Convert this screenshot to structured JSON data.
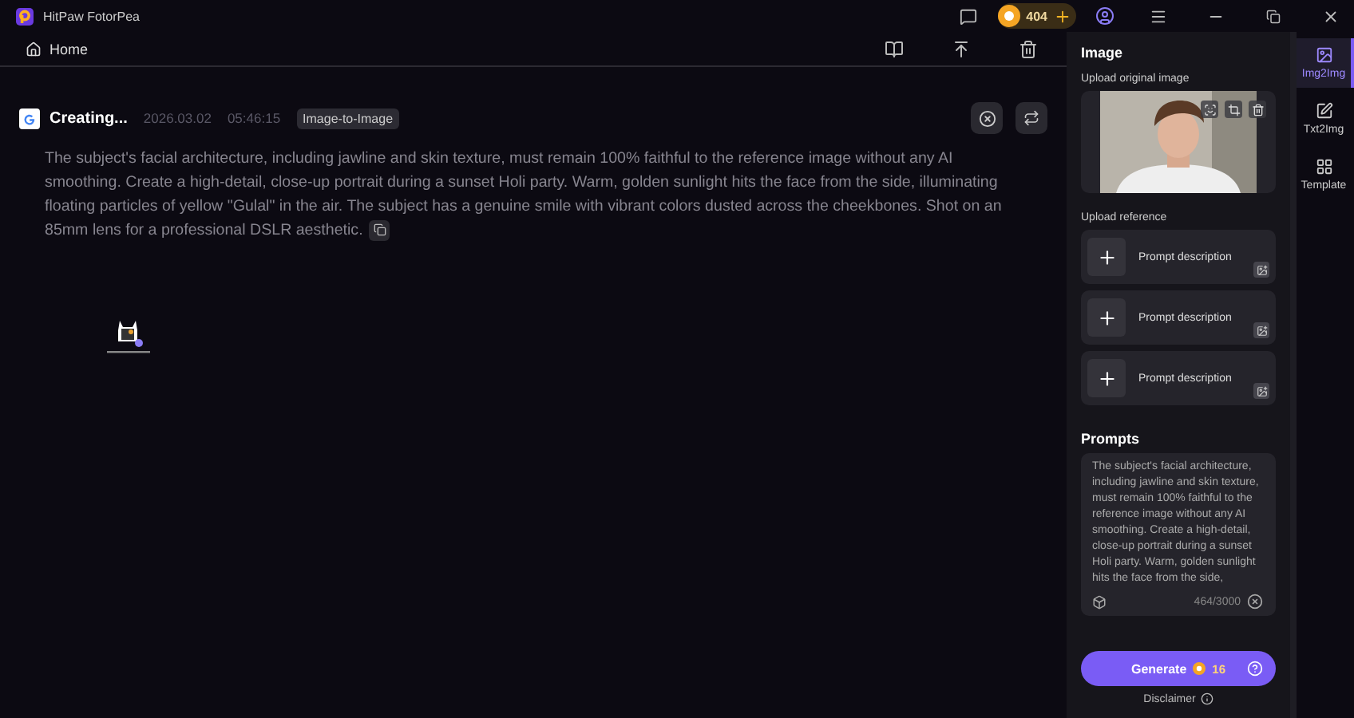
{
  "app": {
    "title": "HitPaw FotorPea",
    "coins": "404"
  },
  "nav": {
    "home": "Home"
  },
  "task": {
    "status": "Creating...",
    "date": "2026.03.02",
    "time": "05:46:15",
    "tag": "Image-to-Image",
    "prompt": "The subject's facial architecture, including jawline and skin texture, must remain 100% faithful to the reference image without any AI smoothing. Create a high-detail, close-up portrait during a sunset Holi party. Warm, golden sunlight hits the face from the side, illuminating floating particles of yellow \"Gulal\" in the air. The subject has a genuine smile with vibrant colors dusted across the cheekbones. Shot on an 85mm lens for a professional DSLR aesthetic."
  },
  "panel": {
    "heading": "Image",
    "upload_label": "Upload original image",
    "reference_label": "Upload reference",
    "references": [
      {
        "label": "Prompt description"
      },
      {
        "label": "Prompt description"
      },
      {
        "label": "Prompt description"
      }
    ],
    "prompts_heading": "Prompts",
    "prompt_value": "The subject's facial architecture, including jawline and skin texture, must remain 100% faithful to the reference image without any AI smoothing. Create a high-detail, close-up portrait during a sunset Holi party. Warm, golden sunlight hits the face from the side,",
    "counter": "464/3000",
    "generate": "Generate",
    "cost": "16",
    "disclaimer": "Disclaimer"
  },
  "tabs": [
    {
      "label": "Img2Img",
      "selected": true
    },
    {
      "label": "Txt2Img",
      "selected": false
    },
    {
      "label": "Template",
      "selected": false
    }
  ]
}
